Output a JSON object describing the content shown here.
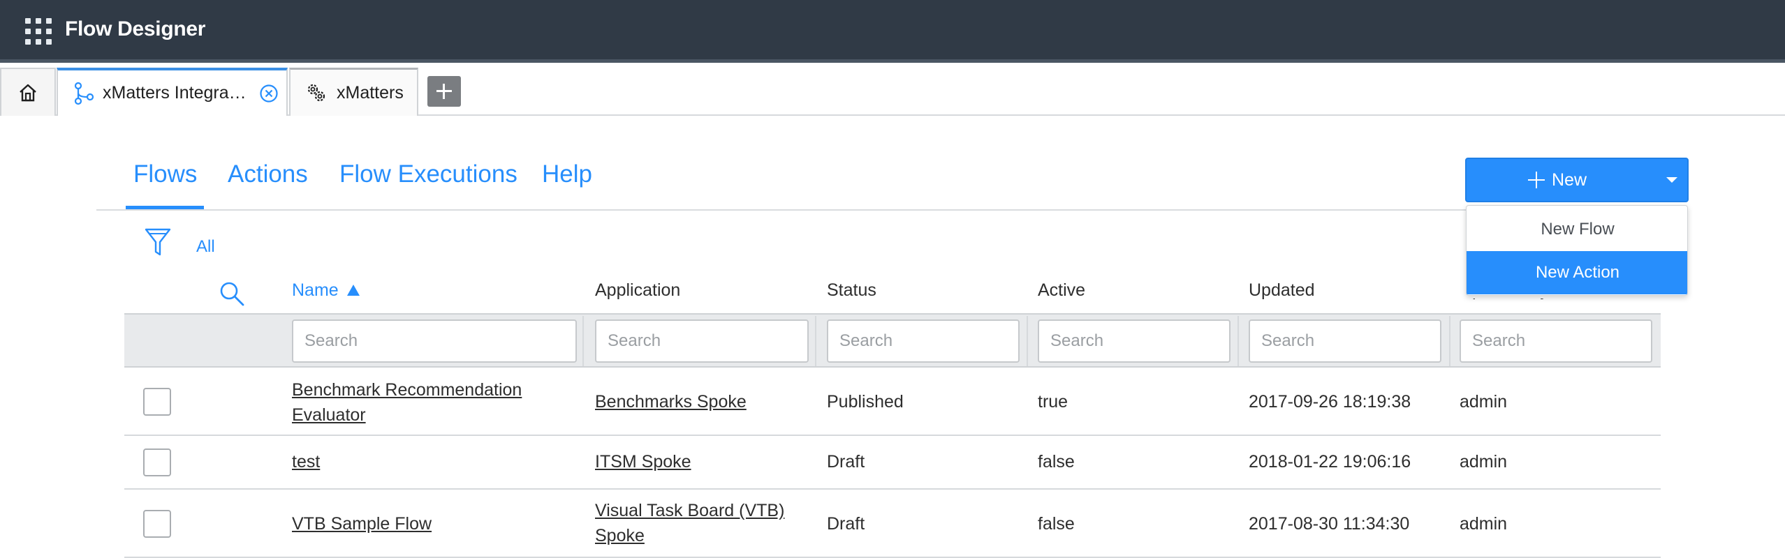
{
  "header": {
    "app_title": "Flow Designer",
    "menu_icon": "waffle-grid-icon"
  },
  "tabs": [
    {
      "label": "",
      "icon": "home-icon"
    },
    {
      "label": "xMatters Integra…",
      "icon": "flow-branch-icon",
      "close_icon": "close-circle-icon",
      "active": true
    },
    {
      "label": "xMatters",
      "icon": "gears-icon"
    }
  ],
  "add_tab_icon": "plus-icon",
  "nav": {
    "items": [
      "Flows",
      "Actions",
      "Flow Executions",
      "Help"
    ],
    "active": "Flows"
  },
  "new_button": {
    "label": "New",
    "menu": [
      "New Flow",
      "New Action"
    ],
    "highlighted": "New Action"
  },
  "filter": {
    "label": "All",
    "icon": "funnel-icon"
  },
  "table": {
    "columns": [
      "Name",
      "Application",
      "Status",
      "Active",
      "Updated",
      "Updated by"
    ],
    "sort": {
      "column": "Name",
      "direction": "ascending"
    },
    "search_placeholder": "Search",
    "rows": [
      {
        "name": "Benchmark Recommendation Evaluator",
        "application": "Benchmarks Spoke",
        "status": "Published",
        "active": "true",
        "updated": "2017-09-26 18:19:38",
        "updated_by": "admin"
      },
      {
        "name": "test",
        "application": "ITSM Spoke",
        "status": "Draft",
        "active": "false",
        "updated": "2018-01-22 19:06:16",
        "updated_by": "admin"
      },
      {
        "name": "VTB Sample Flow",
        "application": "Visual Task Board (VTB) Spoke",
        "status": "Draft",
        "active": "false",
        "updated": "2017-08-30 11:34:30",
        "updated_by": "admin"
      }
    ]
  },
  "colors": {
    "header_bg": "#303a46",
    "accent": "#278efc",
    "tab_active_border": "#3b8fe4"
  }
}
